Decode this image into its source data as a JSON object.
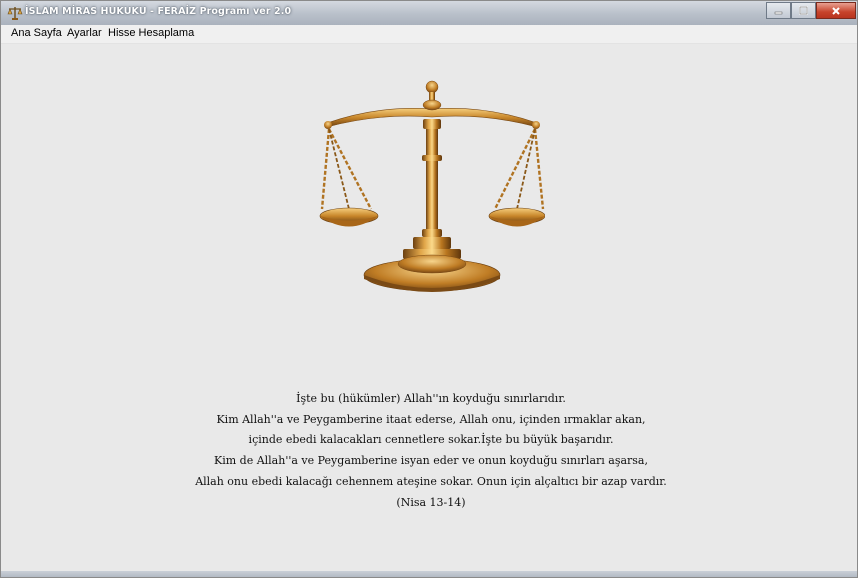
{
  "window": {
    "title": "İSLAM MİRAS HUKUKU - FERAİZ  Programı ver 2.0",
    "app_icon": "scales-icon"
  },
  "menu": {
    "items": [
      {
        "label": "Ana Sayfa"
      },
      {
        "label": "Ayarlar"
      },
      {
        "label": "Hisse Hesaplama"
      }
    ]
  },
  "main": {
    "illustration": "scales-of-justice",
    "quote_lines": [
      "İşte bu (hükümler) Allah''ın koyduğu sınırlarıdır.",
      "Kim Allah''a ve Peygamberine itaat ederse, Allah onu, içinden ırmaklar akan,",
      "içinde ebedi kalacakları cennetlere sokar.İşte bu büyük başarıdır.",
      "Kim de Allah''a ve Peygamberine isyan eder ve onun koyduğu sınırları aşarsa,",
      "Allah onu ebedi kalacağı cehennem ateşine sokar. Onun için alçaltıcı bir azap vardır.",
      "(Nisa 13-14)"
    ]
  },
  "colors": {
    "background": "#e9e9e9",
    "gold": "#c8862a",
    "close_button": "#c7432b"
  }
}
